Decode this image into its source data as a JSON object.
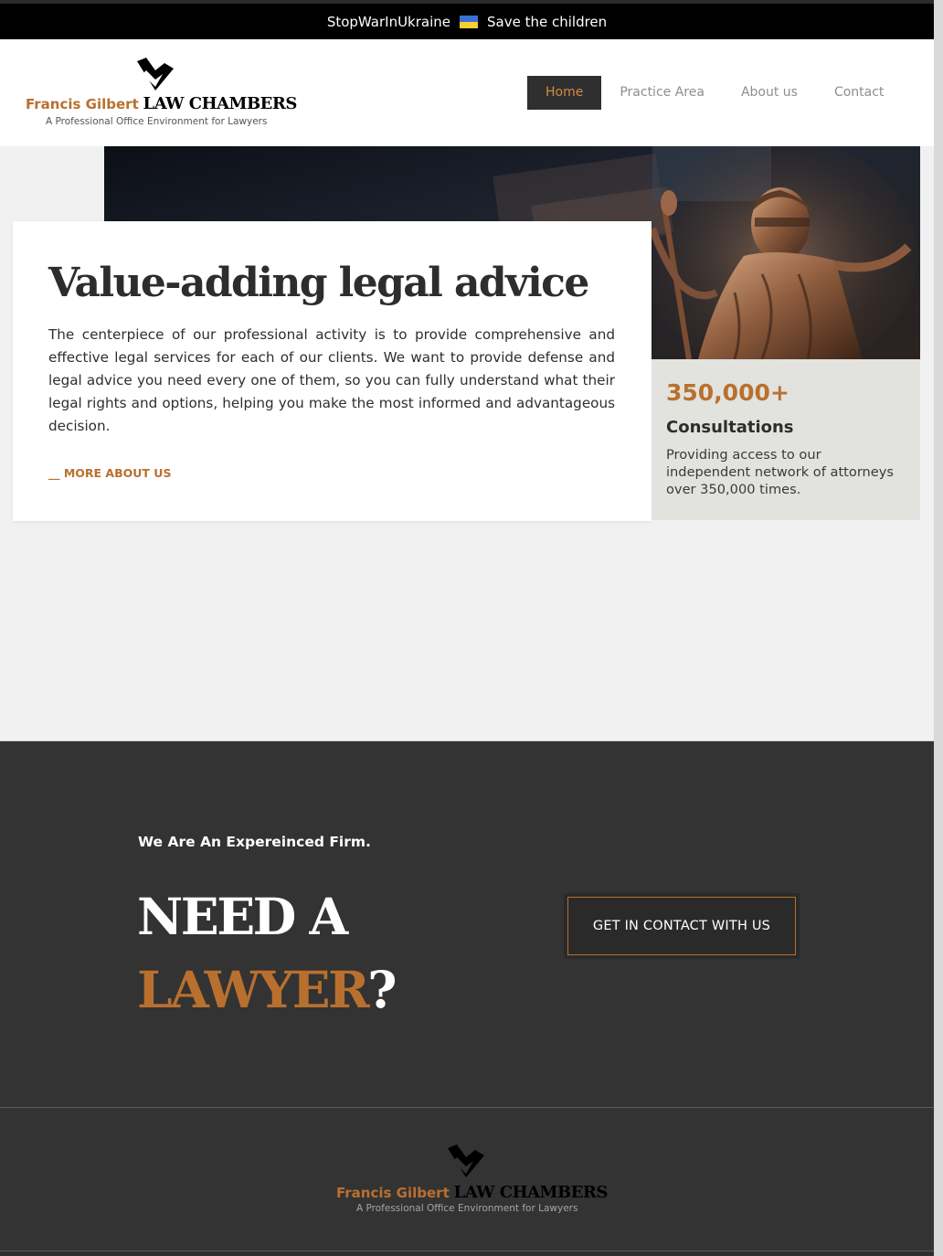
{
  "banner": {
    "left_text": "StopWarInUkraine",
    "right_text": "Save the children",
    "flag_colors": [
      "#3a6fd8",
      "#f6cf2e"
    ]
  },
  "logo": {
    "brand_name": "Francis Gilbert",
    "brand_suffix": "LAW CHAMBERS",
    "tagline": "A Professional Office Environment for Lawyers",
    "mark_icon": "chevron-logo-icon"
  },
  "nav": {
    "items": [
      {
        "label": "Home",
        "active": true
      },
      {
        "label": "Practice Area",
        "active": false
      },
      {
        "label": "About us",
        "active": false
      },
      {
        "label": "Contact",
        "active": false
      }
    ]
  },
  "hero": {
    "image": "lady-justice-statue-image",
    "title": "Value-adding legal advice",
    "body": "The centerpiece of our professional activity is to provide comprehensive and effective legal services for each of our clients. We want to provide defense and legal advice you need every one of them, so you can fully understand what their legal rights and options, helping you make the most informed and advantageous decision.",
    "link_label": "__ MORE ABOUT US"
  },
  "stat": {
    "number": "350,000+",
    "label": "Consultations",
    "description": "Providing access to our independent network of attorneys over 350,000 times."
  },
  "cta_section": {
    "kicker": "We Are An Expereinced Firm.",
    "heading_line1": "NEED A",
    "heading_highlight": "LAWYER",
    "heading_suffix": "?",
    "button_label": "GET IN CONTACT WITH US"
  },
  "footer": {
    "brand_name": "Francis Gilbert",
    "brand_suffix": "LAW CHAMBERS",
    "tagline": "A Professional Office Environment for Lawyers"
  },
  "colors": {
    "accent": "#b9702e",
    "dark": "#333333",
    "nav_active_bg": "#2f2f2f",
    "stat_bg": "#e2e2de"
  }
}
